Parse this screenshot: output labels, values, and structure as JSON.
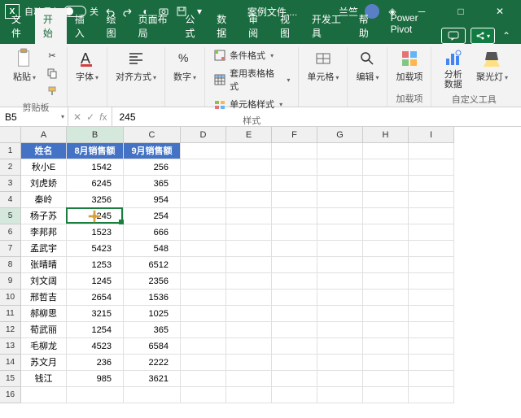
{
  "titlebar": {
    "autosave_label": "自动保存",
    "autosave_state": "关",
    "filename": "案例文件....",
    "username": "兰竺"
  },
  "tabs": {
    "items": [
      "文件",
      "开始",
      "插入",
      "绘图",
      "页面布局",
      "公式",
      "数据",
      "审阅",
      "视图",
      "开发工具",
      "帮助",
      "Power Pivot"
    ],
    "active_index": 1
  },
  "ribbon": {
    "clipboard": {
      "paste": "粘贴",
      "group": "剪贴板"
    },
    "font": {
      "label": "字体"
    },
    "align": {
      "label": "对齐方式"
    },
    "number": {
      "label": "数字"
    },
    "styles": {
      "cond_format": "条件格式",
      "table_format": "套用表格格式",
      "cell_style": "单元格样式",
      "group": "样式"
    },
    "cells": {
      "label": "单元格"
    },
    "editing": {
      "label": "编辑"
    },
    "addins": {
      "label": "加载项",
      "group": "加载项"
    },
    "analysis": {
      "label": "分析数据"
    },
    "spotlight": {
      "label": "聚光灯"
    },
    "custom_group": "自定义工具"
  },
  "formula": {
    "namebox": "B5",
    "value": "245"
  },
  "grid": {
    "columns": [
      "A",
      "B",
      "C",
      "D",
      "E",
      "F",
      "G",
      "H",
      "I"
    ],
    "header_row": [
      "姓名",
      "8月销售额",
      "9月销售额"
    ],
    "rows": [
      {
        "name": "秋小E",
        "aug": "1542",
        "sep": "256"
      },
      {
        "name": "刘虎娇",
        "aug": "6245",
        "sep": "365"
      },
      {
        "name": "秦岭",
        "aug": "3256",
        "sep": "954"
      },
      {
        "name": "杨子苏",
        "aug": "245",
        "sep": "254"
      },
      {
        "name": "李邦邦",
        "aug": "1523",
        "sep": "666"
      },
      {
        "name": "孟武宇",
        "aug": "5423",
        "sep": "548"
      },
      {
        "name": "张晴晴",
        "aug": "1253",
        "sep": "6512"
      },
      {
        "name": "刘文阔",
        "aug": "1245",
        "sep": "2356"
      },
      {
        "name": "邢哲吉",
        "aug": "2654",
        "sep": "1536"
      },
      {
        "name": "郝柳思",
        "aug": "3215",
        "sep": "1025"
      },
      {
        "name": "荀武丽",
        "aug": "1254",
        "sep": "365"
      },
      {
        "name": "毛柳龙",
        "aug": "4523",
        "sep": "6584"
      },
      {
        "name": "苏文月",
        "aug": "236",
        "sep": "2222"
      },
      {
        "name": "钱江",
        "aug": "985",
        "sep": "3621"
      }
    ],
    "selected_cell": "B5"
  }
}
